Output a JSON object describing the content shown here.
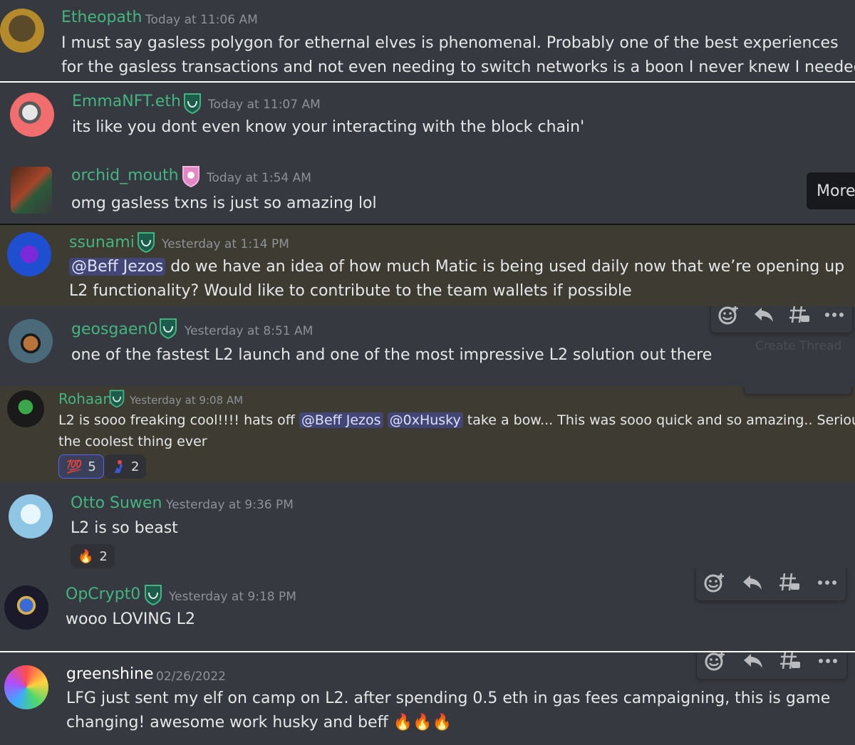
{
  "messages": [
    {
      "username": "Etheopath",
      "timestamp": "Today at 11:06 AM",
      "line1": "I must say gasless polygon for ethernal elves is phenomenal. Probably one of the best experiences",
      "line2": "for the gasless transactions and not even needing to switch networks is a boon I never knew I needed"
    },
    {
      "username": "EmmaNFT.eth",
      "timestamp": "Today at 11:07 AM",
      "text": "its like you dont even know your interacting with the block chain'"
    },
    {
      "username": "orchid_mouth",
      "timestamp": "Today at 1:54 AM",
      "text": "omg gasless txns is just so amazing lol",
      "tooltip": "More"
    },
    {
      "username": "ssunami",
      "timestamp": "Yesterday at 1:14 PM",
      "mention": "@Beff Jezos",
      "line1": "do we have an idea of how much Matic is being used daily now that we’re opening up",
      "line2": "L2 functionality? Would like to contribute to the team wallets if possible"
    },
    {
      "username": "geosgaen0",
      "timestamp": "Yesterday at 8:51 AM",
      "text": "one of the fastest L2 launch and one of the most impressive L2 solution out there",
      "faint": "Create Thread"
    },
    {
      "username": "Rohaan",
      "timestamp": "Yesterday at 9:08 AM",
      "part1": "L2 is sooo freaking cool!!!! hats off",
      "mention1": "@Beff Jezos",
      "mention2": "@0xHusky",
      "part2": "take a bow... This was sooo quick and so amazing.. Seriously this is",
      "line2": "the coolest thing ever",
      "reactions": [
        {
          "emoji": "💯",
          "count": "5"
        },
        {
          "emoji": "elf",
          "count": "2"
        }
      ]
    },
    {
      "username": "Otto Suwen",
      "timestamp": "Yesterday at 9:36 PM",
      "text": "L2 is so beast",
      "reactions": [
        {
          "emoji": "🔥",
          "count": "2"
        }
      ]
    },
    {
      "username": "OpCrypt0",
      "timestamp": "Yesterday at 9:18 PM",
      "text": "wooo LOVING L2"
    },
    {
      "username": "greenshine",
      "timestamp": "02/26/2022",
      "line1": "LFG just sent my elf on camp on L2. after spending 0.5 eth in gas fees campaigning, this is game",
      "line2": "changing! awesome work husky and beff",
      "emoji": "🔥🔥🔥"
    }
  ],
  "colors": {
    "background": "#36393f",
    "highlight": "#3e3b33",
    "username_green": "#43b581",
    "username_white": "#ffffff",
    "timestamp": "#8e9297",
    "mention_bg": "#414675"
  },
  "toolbar_icons": [
    "add-reaction-icon",
    "reply-icon",
    "create-thread-icon",
    "more-icon"
  ]
}
